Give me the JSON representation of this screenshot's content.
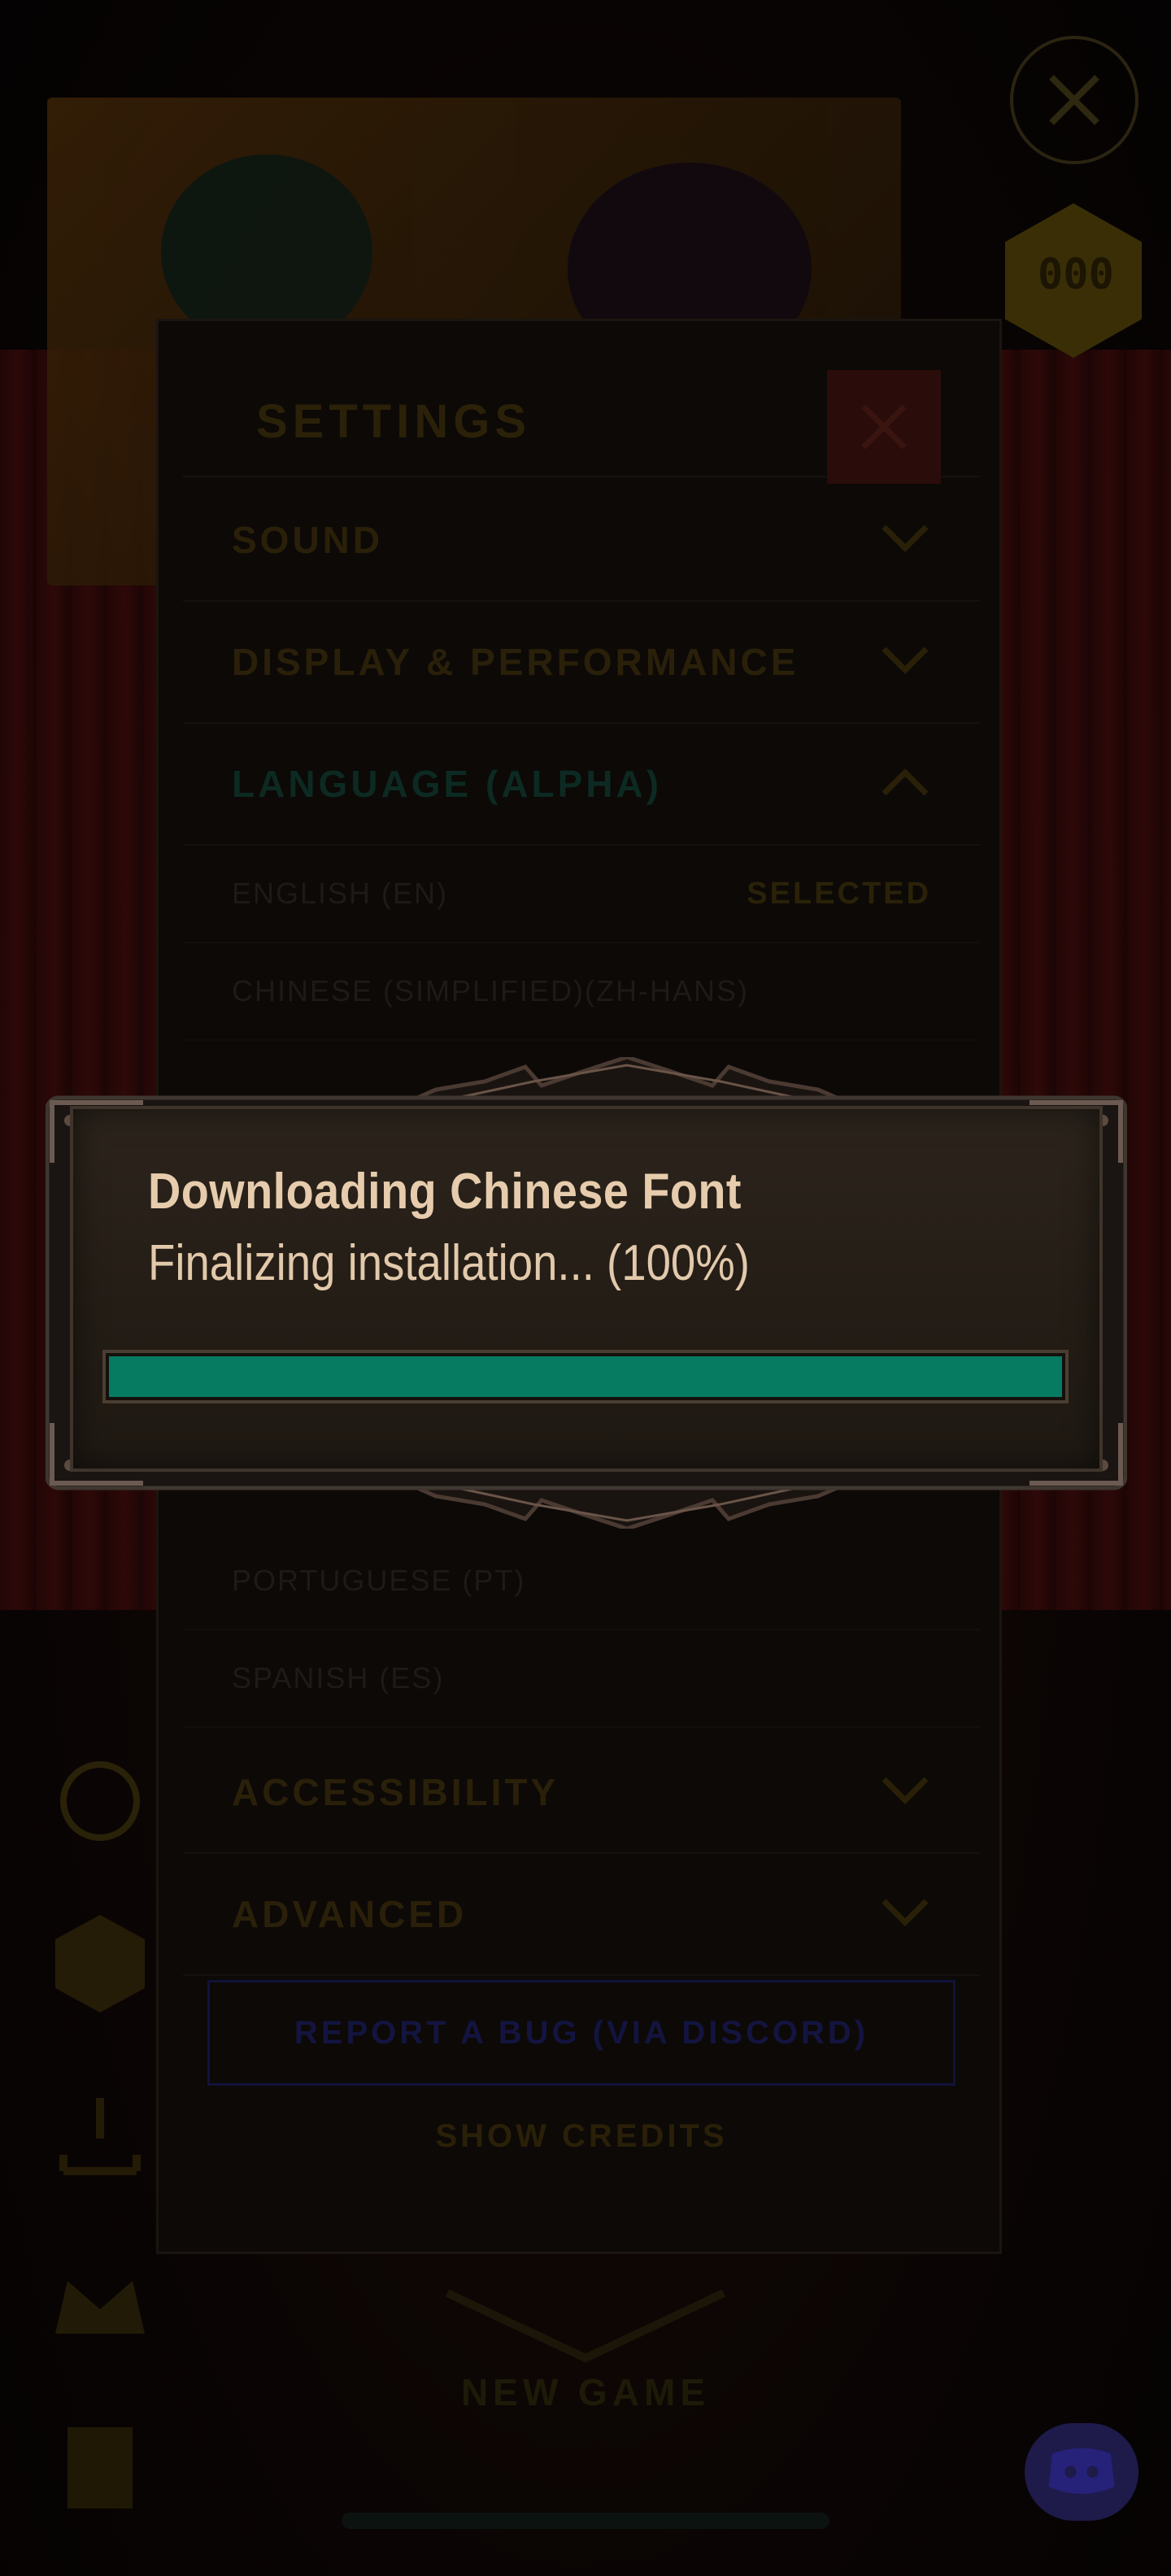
{
  "background": {
    "close_icon": "close-x-icon",
    "gem_counter": "000"
  },
  "settings": {
    "title": "SETTINGS",
    "sections": [
      {
        "label": "SOUND",
        "expanded": false
      },
      {
        "label": "DISPLAY & PERFORMANCE",
        "expanded": false
      },
      {
        "label": "LANGUAGE (ALPHA)",
        "expanded": true
      }
    ],
    "languages": [
      {
        "label": "ENGLISH (EN)",
        "status": "SELECTED"
      },
      {
        "label": "CHINESE (SIMPLIFIED)(ZH-HANS)",
        "status": ""
      },
      {
        "label": "PORTUGUESE (PT)",
        "status": ""
      },
      {
        "label": "SPANISH (ES)",
        "status": ""
      }
    ],
    "more_sections": [
      {
        "label": "ACCESSIBILITY",
        "expanded": false
      },
      {
        "label": "ADVANCED",
        "expanded": false
      }
    ],
    "report_bug_label": "REPORT A BUG (VIA DISCORD)",
    "show_credits_label": "SHOW CREDITS"
  },
  "footer": {
    "new_game_label": "NEW GAME"
  },
  "dialog": {
    "title": "Downloading Chinese Font",
    "status": "Finalizing installation... (100%)",
    "progress": 1.0,
    "progress_color": "#077a62"
  }
}
